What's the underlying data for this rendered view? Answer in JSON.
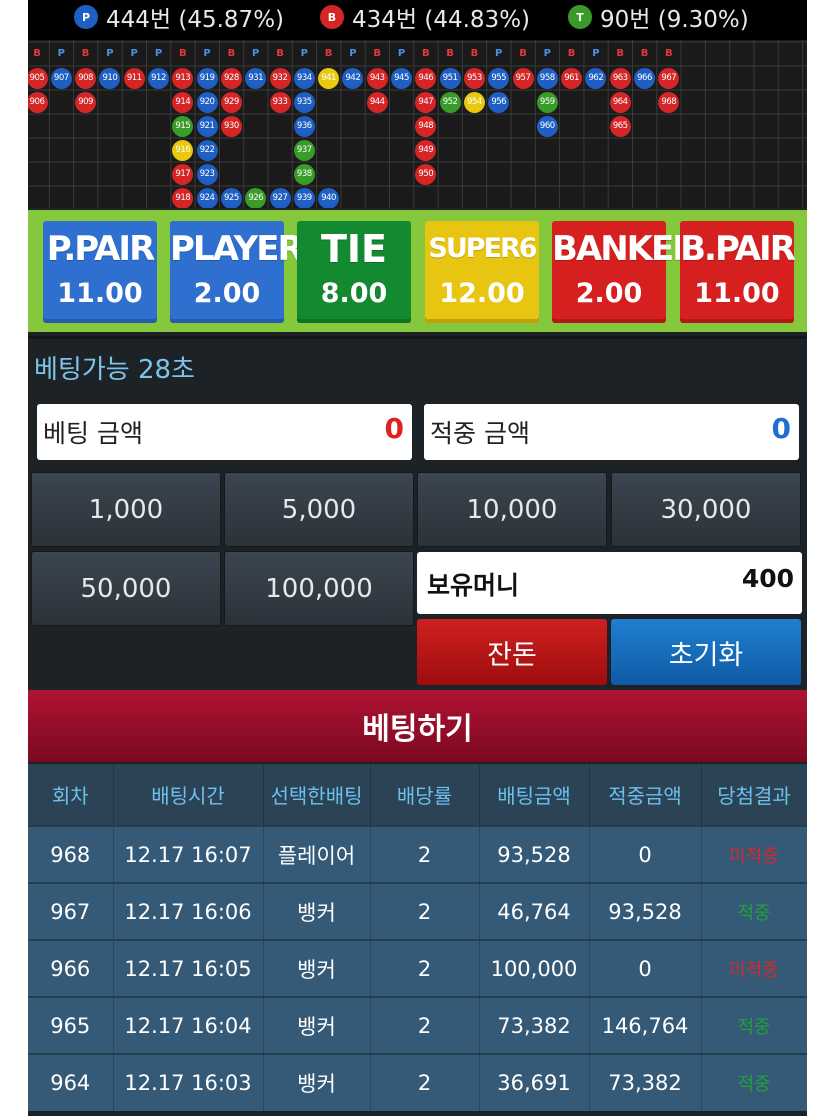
{
  "stats": {
    "player": {
      "badge": "P",
      "text": "444번 (45.87%)",
      "color": "#1f5fc4"
    },
    "banker": {
      "badge": "B",
      "text": "434번 (44.83%)",
      "color": "#d42626"
    },
    "tie": {
      "badge": "T",
      "text": "90번 (9.30%)",
      "color": "#3a9c28"
    }
  },
  "road": {
    "headers": [
      "B",
      "P",
      "B",
      "P",
      "P",
      "P",
      "B",
      "P",
      "B",
      "P",
      "B",
      "P",
      "B",
      "P",
      "B",
      "P",
      "B",
      "B",
      "B",
      "P",
      "B",
      "P",
      "B",
      "P",
      "B",
      "B",
      "B"
    ],
    "columns": [
      [
        {
          "n": "905",
          "c": "B"
        },
        {
          "n": "906",
          "c": "B"
        }
      ],
      [
        {
          "n": "907",
          "c": "P"
        }
      ],
      [
        {
          "n": "908",
          "c": "B"
        },
        {
          "n": "909",
          "c": "B"
        }
      ],
      [
        {
          "n": "910",
          "c": "P"
        }
      ],
      [
        {
          "n": "911",
          "c": "B"
        }
      ],
      [
        {
          "n": "912",
          "c": "P"
        }
      ],
      [
        {
          "n": "913",
          "c": "B"
        },
        {
          "n": "914",
          "c": "B"
        },
        {
          "n": "915",
          "c": "T"
        },
        {
          "n": "916",
          "c": "S"
        },
        {
          "n": "917",
          "c": "B"
        },
        {
          "n": "918",
          "c": "B"
        }
      ],
      [
        {
          "n": "919",
          "c": "P"
        },
        {
          "n": "920",
          "c": "P"
        },
        {
          "n": "921",
          "c": "P"
        },
        {
          "n": "922",
          "c": "P"
        },
        {
          "n": "923",
          "c": "P"
        },
        {
          "n": "924",
          "c": "P"
        }
      ],
      [
        {
          "n": "928",
          "c": "B"
        },
        {
          "n": "929",
          "c": "B"
        },
        {
          "n": "930",
          "c": "B"
        },
        null,
        null,
        {
          "n": "925",
          "c": "P"
        }
      ],
      [
        {
          "n": "931",
          "c": "P"
        },
        null,
        null,
        null,
        null,
        {
          "n": "926",
          "c": "T"
        }
      ],
      [
        {
          "n": "932",
          "c": "B"
        },
        {
          "n": "933",
          "c": "B"
        },
        null,
        null,
        null,
        {
          "n": "927",
          "c": "P"
        }
      ],
      [
        {
          "n": "934",
          "c": "P"
        },
        {
          "n": "935",
          "c": "P"
        },
        {
          "n": "936",
          "c": "P"
        },
        {
          "n": "937",
          "c": "T"
        },
        {
          "n": "938",
          "c": "T"
        },
        {
          "n": "939",
          "c": "P"
        }
      ],
      [
        {
          "n": "941",
          "c": "S"
        },
        null,
        null,
        null,
        null,
        {
          "n": "940",
          "c": "P"
        }
      ],
      [
        {
          "n": "942",
          "c": "P"
        }
      ],
      [
        {
          "n": "943",
          "c": "B"
        },
        {
          "n": "944",
          "c": "B"
        }
      ],
      [
        {
          "n": "945",
          "c": "P"
        }
      ],
      [
        {
          "n": "946",
          "c": "B"
        },
        {
          "n": "947",
          "c": "B"
        },
        {
          "n": "948",
          "c": "B"
        },
        {
          "n": "949",
          "c": "B"
        },
        {
          "n": "950",
          "c": "B"
        }
      ],
      [
        {
          "n": "951",
          "c": "P"
        },
        {
          "n": "952",
          "c": "T"
        }
      ],
      [
        {
          "n": "953",
          "c": "B"
        },
        {
          "n": "954",
          "c": "S"
        }
      ],
      [
        {
          "n": "955",
          "c": "P"
        },
        {
          "n": "956",
          "c": "P"
        }
      ],
      [
        {
          "n": "957",
          "c": "B"
        }
      ],
      [
        {
          "n": "958",
          "c": "P"
        },
        {
          "n": "959",
          "c": "T"
        },
        {
          "n": "960",
          "c": "P"
        }
      ],
      [
        {
          "n": "961",
          "c": "B"
        }
      ],
      [
        {
          "n": "962",
          "c": "P"
        }
      ],
      [
        {
          "n": "963",
          "c": "B"
        },
        {
          "n": "964",
          "c": "B"
        },
        {
          "n": "965",
          "c": "B"
        }
      ],
      [
        {
          "n": "966",
          "c": "P"
        }
      ],
      [
        {
          "n": "967",
          "c": "B"
        },
        {
          "n": "968",
          "c": "B"
        }
      ]
    ]
  },
  "bets": [
    {
      "name": "P.PAIR",
      "odds": "11.00",
      "style": "bb-blue"
    },
    {
      "name": "PLAYER",
      "odds": "2.00",
      "style": "bb-blue"
    },
    {
      "name": "TIE",
      "odds": "8.00",
      "style": "bb-green"
    },
    {
      "name": "SUPER6",
      "odds": "12.00",
      "style": "bb-yellow"
    },
    {
      "name": "BANKER",
      "odds": "2.00",
      "style": "bb-red"
    },
    {
      "name": "B.PAIR",
      "odds": "11.00",
      "style": "bb-red"
    }
  ],
  "countdown": "베팅가능 28초",
  "amounts": {
    "bet_label": "베팅 금액",
    "bet_value": "0",
    "bet_color": "#e02020",
    "win_label": "적중 금액",
    "win_value": "0",
    "win_color": "#1f6fd0"
  },
  "chips": [
    "1,000",
    "5,000",
    "10,000",
    "30,000",
    "50,000",
    "100,000"
  ],
  "holdings": {
    "label": "보유머니",
    "value": "400"
  },
  "buttons": {
    "change": "잔돈",
    "reset": "초기화",
    "place_bet": "베팅하기"
  },
  "history": {
    "headers": [
      "회차",
      "배팅시간",
      "선택한배팅",
      "배당률",
      "배팅금액",
      "적중금액",
      "당첨결과"
    ],
    "rows": [
      {
        "round": "968",
        "time": "12.17 16:07",
        "choice": "플레이어",
        "odds": "2",
        "bet": "93,528",
        "win": "0",
        "result": "미적중",
        "won": false
      },
      {
        "round": "967",
        "time": "12.17 16:06",
        "choice": "뱅커",
        "odds": "2",
        "bet": "46,764",
        "win": "93,528",
        "result": "적중",
        "won": true
      },
      {
        "round": "966",
        "time": "12.17 16:05",
        "choice": "뱅커",
        "odds": "2",
        "bet": "100,000",
        "win": "0",
        "result": "미적중",
        "won": false
      },
      {
        "round": "965",
        "time": "12.17 16:04",
        "choice": "뱅커",
        "odds": "2",
        "bet": "73,382",
        "win": "146,764",
        "result": "적중",
        "won": true
      },
      {
        "round": "964",
        "time": "12.17 16:03",
        "choice": "뱅커",
        "odds": "2",
        "bet": "36,691",
        "win": "73,382",
        "result": "적중",
        "won": true
      }
    ]
  }
}
